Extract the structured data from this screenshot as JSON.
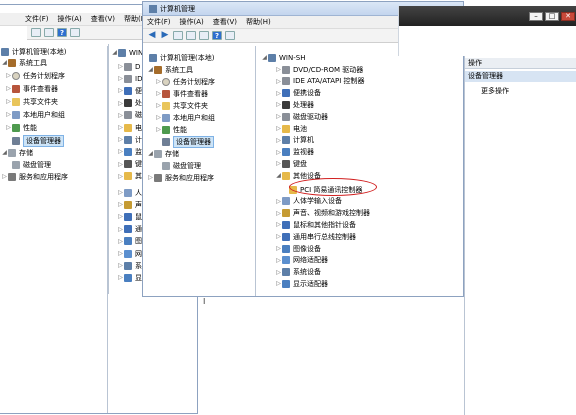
{
  "win1": {
    "menu": [
      "文件(F)",
      "操作(A)",
      "查看(V)",
      "帮助(H)"
    ],
    "tree": {
      "root": "计算机管理(本地)",
      "system_tools": "系统工具",
      "task_scheduler": "任务计划程序",
      "event_viewer": "事件查看器",
      "shared_folders": "共享文件夹",
      "local_users": "本地用户和组",
      "performance": "性能",
      "device_manager": "设备管理器",
      "storage": "存储",
      "disk_management": "磁盘管理",
      "services_apps": "服务和应用程序"
    }
  },
  "win2": {
    "computer": "WIN-",
    "partial_items": [
      "D",
      "ID",
      "便",
      "处",
      "磁",
      "电",
      "计",
      "监",
      "键",
      "其",
      "人",
      "声",
      "鼠",
      "通",
      "图",
      "网",
      "系",
      "显"
    ]
  },
  "win3": {
    "title": "计算机管理",
    "menu": [
      "文件(F)",
      "操作(A)",
      "查看(V)",
      "帮助(H)"
    ],
    "tree": {
      "root": "计算机管理(本地)",
      "system_tools": "系统工具",
      "task_scheduler": "任务计划程序",
      "event_viewer": "事件查看器",
      "shared_folders": "共享文件夹",
      "local_users": "本地用户和组",
      "performance": "性能",
      "device_manager": "设备管理器",
      "storage": "存储",
      "disk_management": "磁盘管理",
      "services_apps": "服务和应用程序"
    },
    "devices": {
      "computer": "WIN-SH",
      "items": [
        "DVD/CD-ROM 驱动器",
        "IDE ATA/ATAPI 控制器",
        "便携设备",
        "处理器",
        "磁盘驱动器",
        "电池",
        "计算机",
        "监视器",
        "键盘",
        "其他设备",
        "PCI 简易通讯控制器",
        "人体学输入设备",
        "声音、视频和游戏控制器",
        "鼠标和其他指针设备",
        "通用串行总线控制器",
        "图像设备",
        "网络适配器",
        "系统设备",
        "显示适配器"
      ]
    }
  },
  "actions": {
    "header": "操作",
    "section": "设备管理器",
    "more": "更多操作"
  },
  "misc": {
    "cursor": "I"
  }
}
